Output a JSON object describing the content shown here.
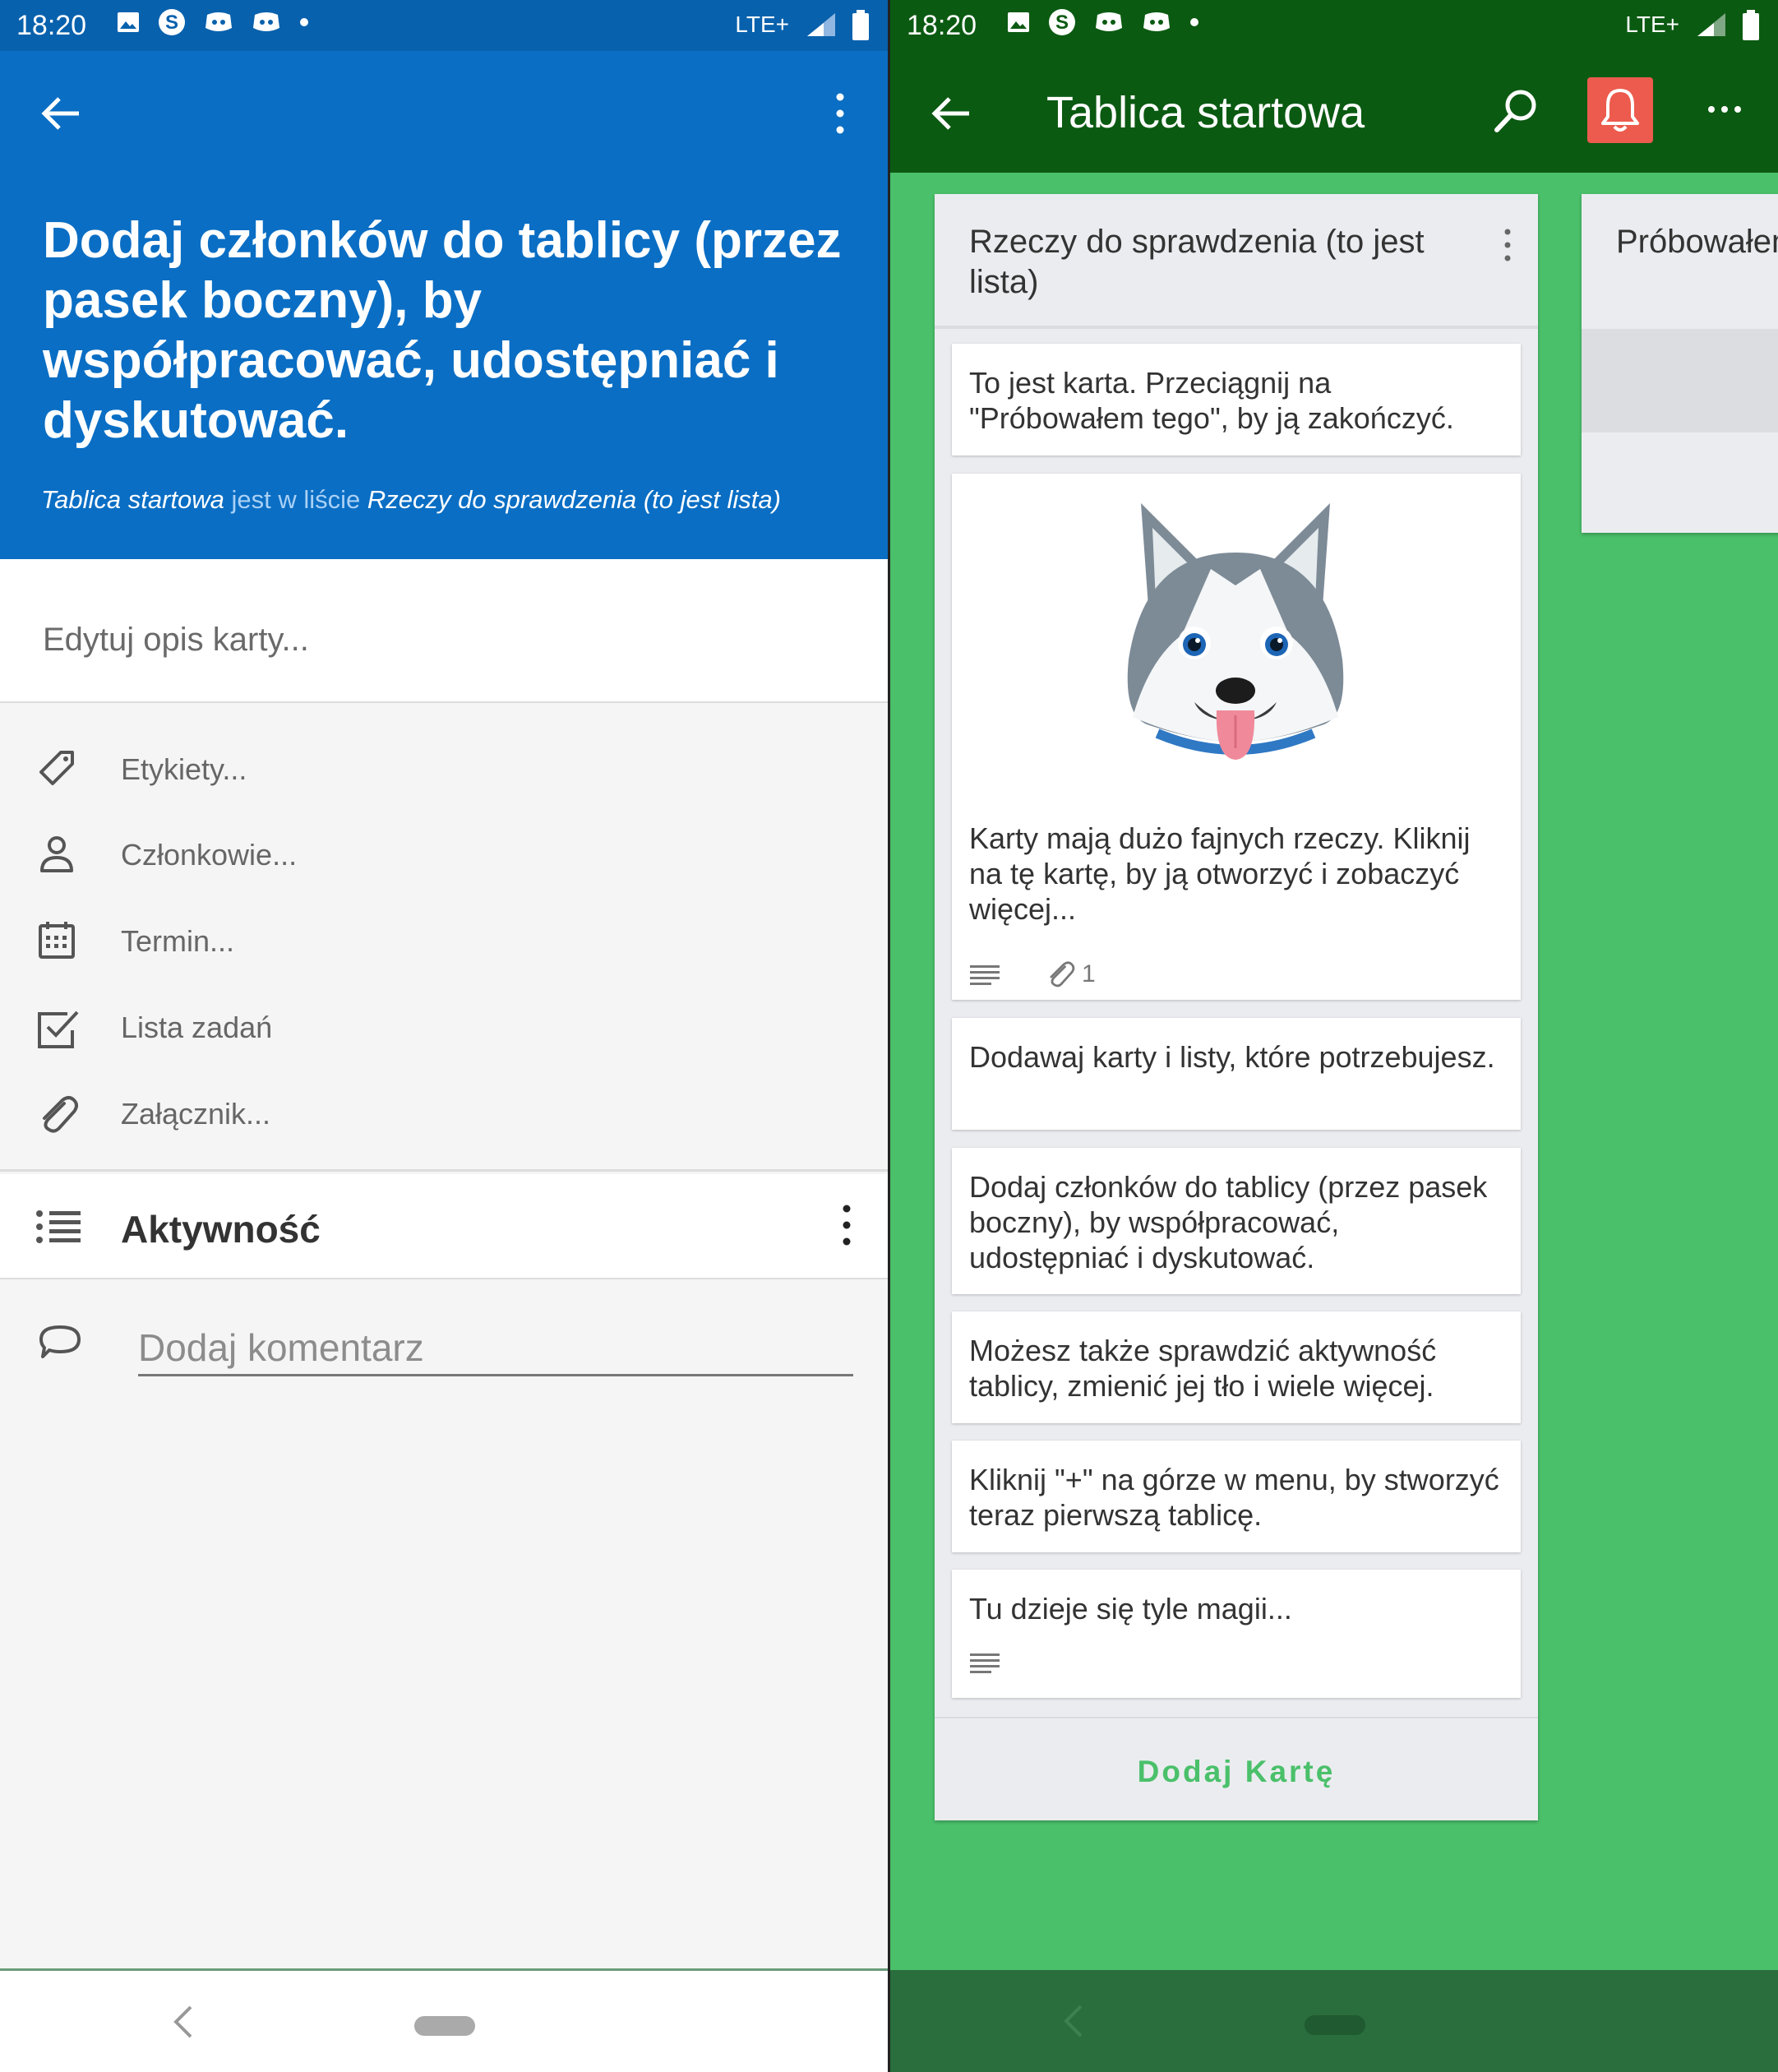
{
  "status": {
    "time": "18:20",
    "network": "LTE+"
  },
  "left": {
    "card_title": "Dodaj członków do tablicy (przez pasek boczny), by współpracować, udostępniać i dyskutować.",
    "board_name": "Tablica startowa",
    "in_list_text": " jest w liście ",
    "list_name": "Rzeczy do sprawdzenia (to jest lista)",
    "description_placeholder": "Edytuj opis karty...",
    "menu": [
      {
        "label": "Etykiety...",
        "icon": "tag-icon"
      },
      {
        "label": "Członkowie...",
        "icon": "person-icon"
      },
      {
        "label": "Termin...",
        "icon": "calendar-icon"
      },
      {
        "label": "Lista zadań",
        "icon": "checklist-icon"
      },
      {
        "label": "Załącznik...",
        "icon": "paperclip-icon"
      }
    ],
    "activity_label": "Aktywność",
    "comment_placeholder": "Dodaj komentarz",
    "colors": {
      "header": "#0a6ec4",
      "statusbar": "#0861ad"
    }
  },
  "right": {
    "board_title": "Tablica startowa",
    "list_title": "Rzeczy do sprawdzenia (to jest lista)",
    "cards": [
      {
        "text": "To jest karta. Przeciągnij na \"Próbowałem tego\", by ją zakończyć."
      },
      {
        "text": "Karty mają dużo fajnych rzeczy. Kliknij na tę kartę, by ją otworzyć i zobaczyć więcej...",
        "image": "husky-illustration",
        "attachments": "1"
      },
      {
        "text": "Dodawaj karty i listy, które potrzebujesz."
      },
      {
        "text": "Dodaj członków do tablicy (przez pasek boczny), by współpracować, udostępniać i dyskutować."
      },
      {
        "text": "Możesz także sprawdzić aktywność tablicy, zmienić jej tło i wiele więcej."
      },
      {
        "text": "Kliknij \"+\" na górze w menu, by stworzyć teraz pierwszą tablicę."
      },
      {
        "text": "Tu dzieje się tyle magii..."
      }
    ],
    "add_card_label": "Dodaj Kartę",
    "second_list_title": "Próbowałem tego (to jest lista)",
    "colors": {
      "background": "#4ac06a",
      "appbar": "#0b5a12",
      "bell": "#ec5b4e"
    }
  }
}
